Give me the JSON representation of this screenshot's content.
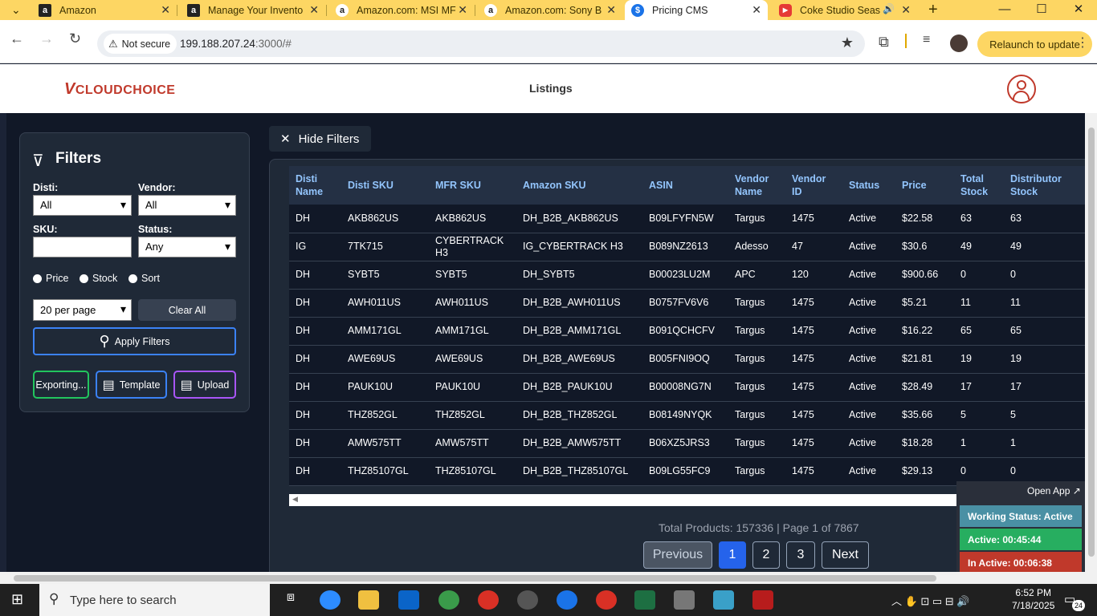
{
  "browser": {
    "tabs": [
      {
        "title": "Amazon",
        "icon": "amazon-icon"
      },
      {
        "title": "Manage Your Invento",
        "icon": "amazon-icon"
      },
      {
        "title": "Amazon.com: MSI MF",
        "icon": "amazon-icon"
      },
      {
        "title": "Amazon.com: Sony B",
        "icon": "amazon-icon"
      },
      {
        "title": "Pricing CMS",
        "icon": "dollar-icon",
        "active": true
      },
      {
        "title": "Coke Studio Seas",
        "icon": "youtube-icon"
      }
    ],
    "not_secure": "Not secure",
    "url_host": "199.188.207.24",
    "url_rest": ":3000/#",
    "relaunch": "Relaunch to update"
  },
  "app": {
    "logo_v": "V",
    "logo_text": "CLOUDCHOICE",
    "nav_title": "Listings"
  },
  "filters": {
    "title": "Filters",
    "disti_label": "Disti:",
    "disti_value": "All",
    "vendor_label": "Vendor:",
    "vendor_value": "All",
    "sku_label": "SKU:",
    "sku_value": "",
    "status_label": "Status:",
    "status_value": "Any",
    "radio_price": "Price",
    "radio_stock": "Stock",
    "radio_sort": "Sort",
    "per_page": "20 per page",
    "clear_all": "Clear All",
    "apply": "Apply Filters",
    "exporting": "Exporting...",
    "template": "Template",
    "upload": "Upload"
  },
  "hide_filters": "Hide Filters",
  "table": {
    "headers": [
      "Disti Name",
      "Disti SKU",
      "MFR SKU",
      "Amazon SKU",
      "ASIN",
      "Vendor Name",
      "Vendor ID",
      "Status",
      "Price",
      "Total Stock",
      "Distributor Stock"
    ],
    "rows": [
      [
        "DH",
        "AKB862US",
        "AKB862US",
        "DH_B2B_AKB862US",
        "B09LFYFN5W",
        "Targus",
        "1475",
        "Active",
        "$22.58",
        "63",
        "63"
      ],
      [
        "IG",
        "7TK715",
        "CYBERTRACK H3",
        "IG_CYBERTRACK H3",
        "B089NZ2613",
        "Adesso",
        "47",
        "Active",
        "$30.6",
        "49",
        "49"
      ],
      [
        "DH",
        "SYBT5",
        "SYBT5",
        "DH_SYBT5",
        "B00023LU2M",
        "APC",
        "120",
        "Active",
        "$900.66",
        "0",
        "0"
      ],
      [
        "DH",
        "AWH011US",
        "AWH011US",
        "DH_B2B_AWH011US",
        "B0757FV6V6",
        "Targus",
        "1475",
        "Active",
        "$5.21",
        "11",
        "11"
      ],
      [
        "DH",
        "AMM171GL",
        "AMM171GL",
        "DH_B2B_AMM171GL",
        "B091QCHCFV",
        "Targus",
        "1475",
        "Active",
        "$16.22",
        "65",
        "65"
      ],
      [
        "DH",
        "AWE69US",
        "AWE69US",
        "DH_B2B_AWE69US",
        "B005FNI9OQ",
        "Targus",
        "1475",
        "Active",
        "$21.81",
        "19",
        "19"
      ],
      [
        "DH",
        "PAUK10U",
        "PAUK10U",
        "DH_B2B_PAUK10U",
        "B00008NG7N",
        "Targus",
        "1475",
        "Active",
        "$28.49",
        "17",
        "17"
      ],
      [
        "DH",
        "THZ852GL",
        "THZ852GL",
        "DH_B2B_THZ852GL",
        "B08149NYQK",
        "Targus",
        "1475",
        "Active",
        "$35.66",
        "5",
        "5"
      ],
      [
        "DH",
        "AMW575TT",
        "AMW575TT",
        "DH_B2B_AMW575TT",
        "B06XZ5JRS3",
        "Targus",
        "1475",
        "Active",
        "$18.28",
        "1",
        "1"
      ],
      [
        "DH",
        "THZ85107GL",
        "THZ85107GL",
        "DH_B2B_THZ85107GL",
        "B09LG55FC9",
        "Targus",
        "1475",
        "Active",
        "$29.13",
        "0",
        "0"
      ]
    ]
  },
  "pagination": {
    "summary": "Total Products: 157336 | Page 1 of 7867",
    "previous": "Previous",
    "pages": [
      "1",
      "2",
      "3"
    ],
    "next": "Next",
    "current": "1"
  },
  "widget": {
    "open_app": "Open App ↗",
    "working": "Working Status: Active",
    "active": "Active: 00:45:44",
    "inactive": "In Active: 00:06:38"
  },
  "taskbar": {
    "search_placeholder": "Type here to search",
    "time": "6:52 PM",
    "date": "7/18/2025",
    "notif_count": "24"
  },
  "colors": {
    "tabbar": "#fdd663",
    "accent_red": "#c0392b",
    "working": "#4a90a4",
    "active": "#27ae60",
    "inactive": "#c0392b"
  }
}
